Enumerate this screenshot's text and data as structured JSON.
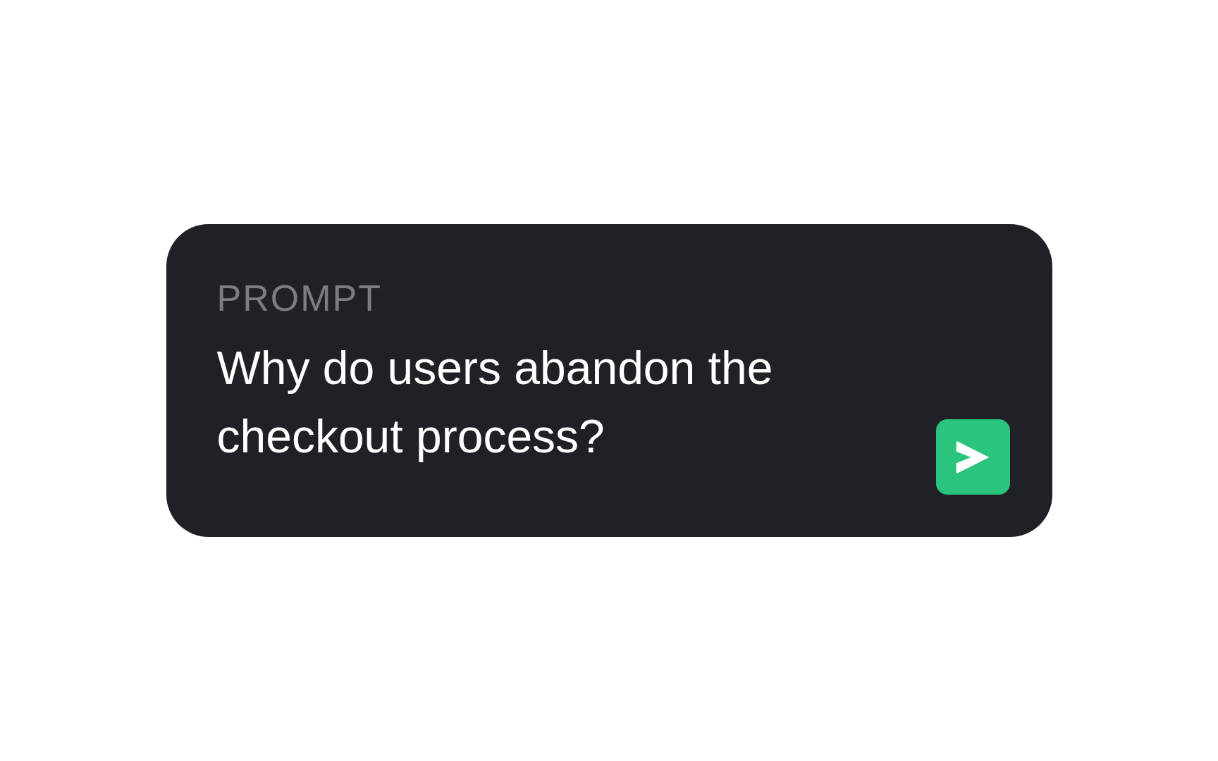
{
  "prompt_card": {
    "label": "PROMPT",
    "text": "Why do users abandon the checkout process?"
  }
}
